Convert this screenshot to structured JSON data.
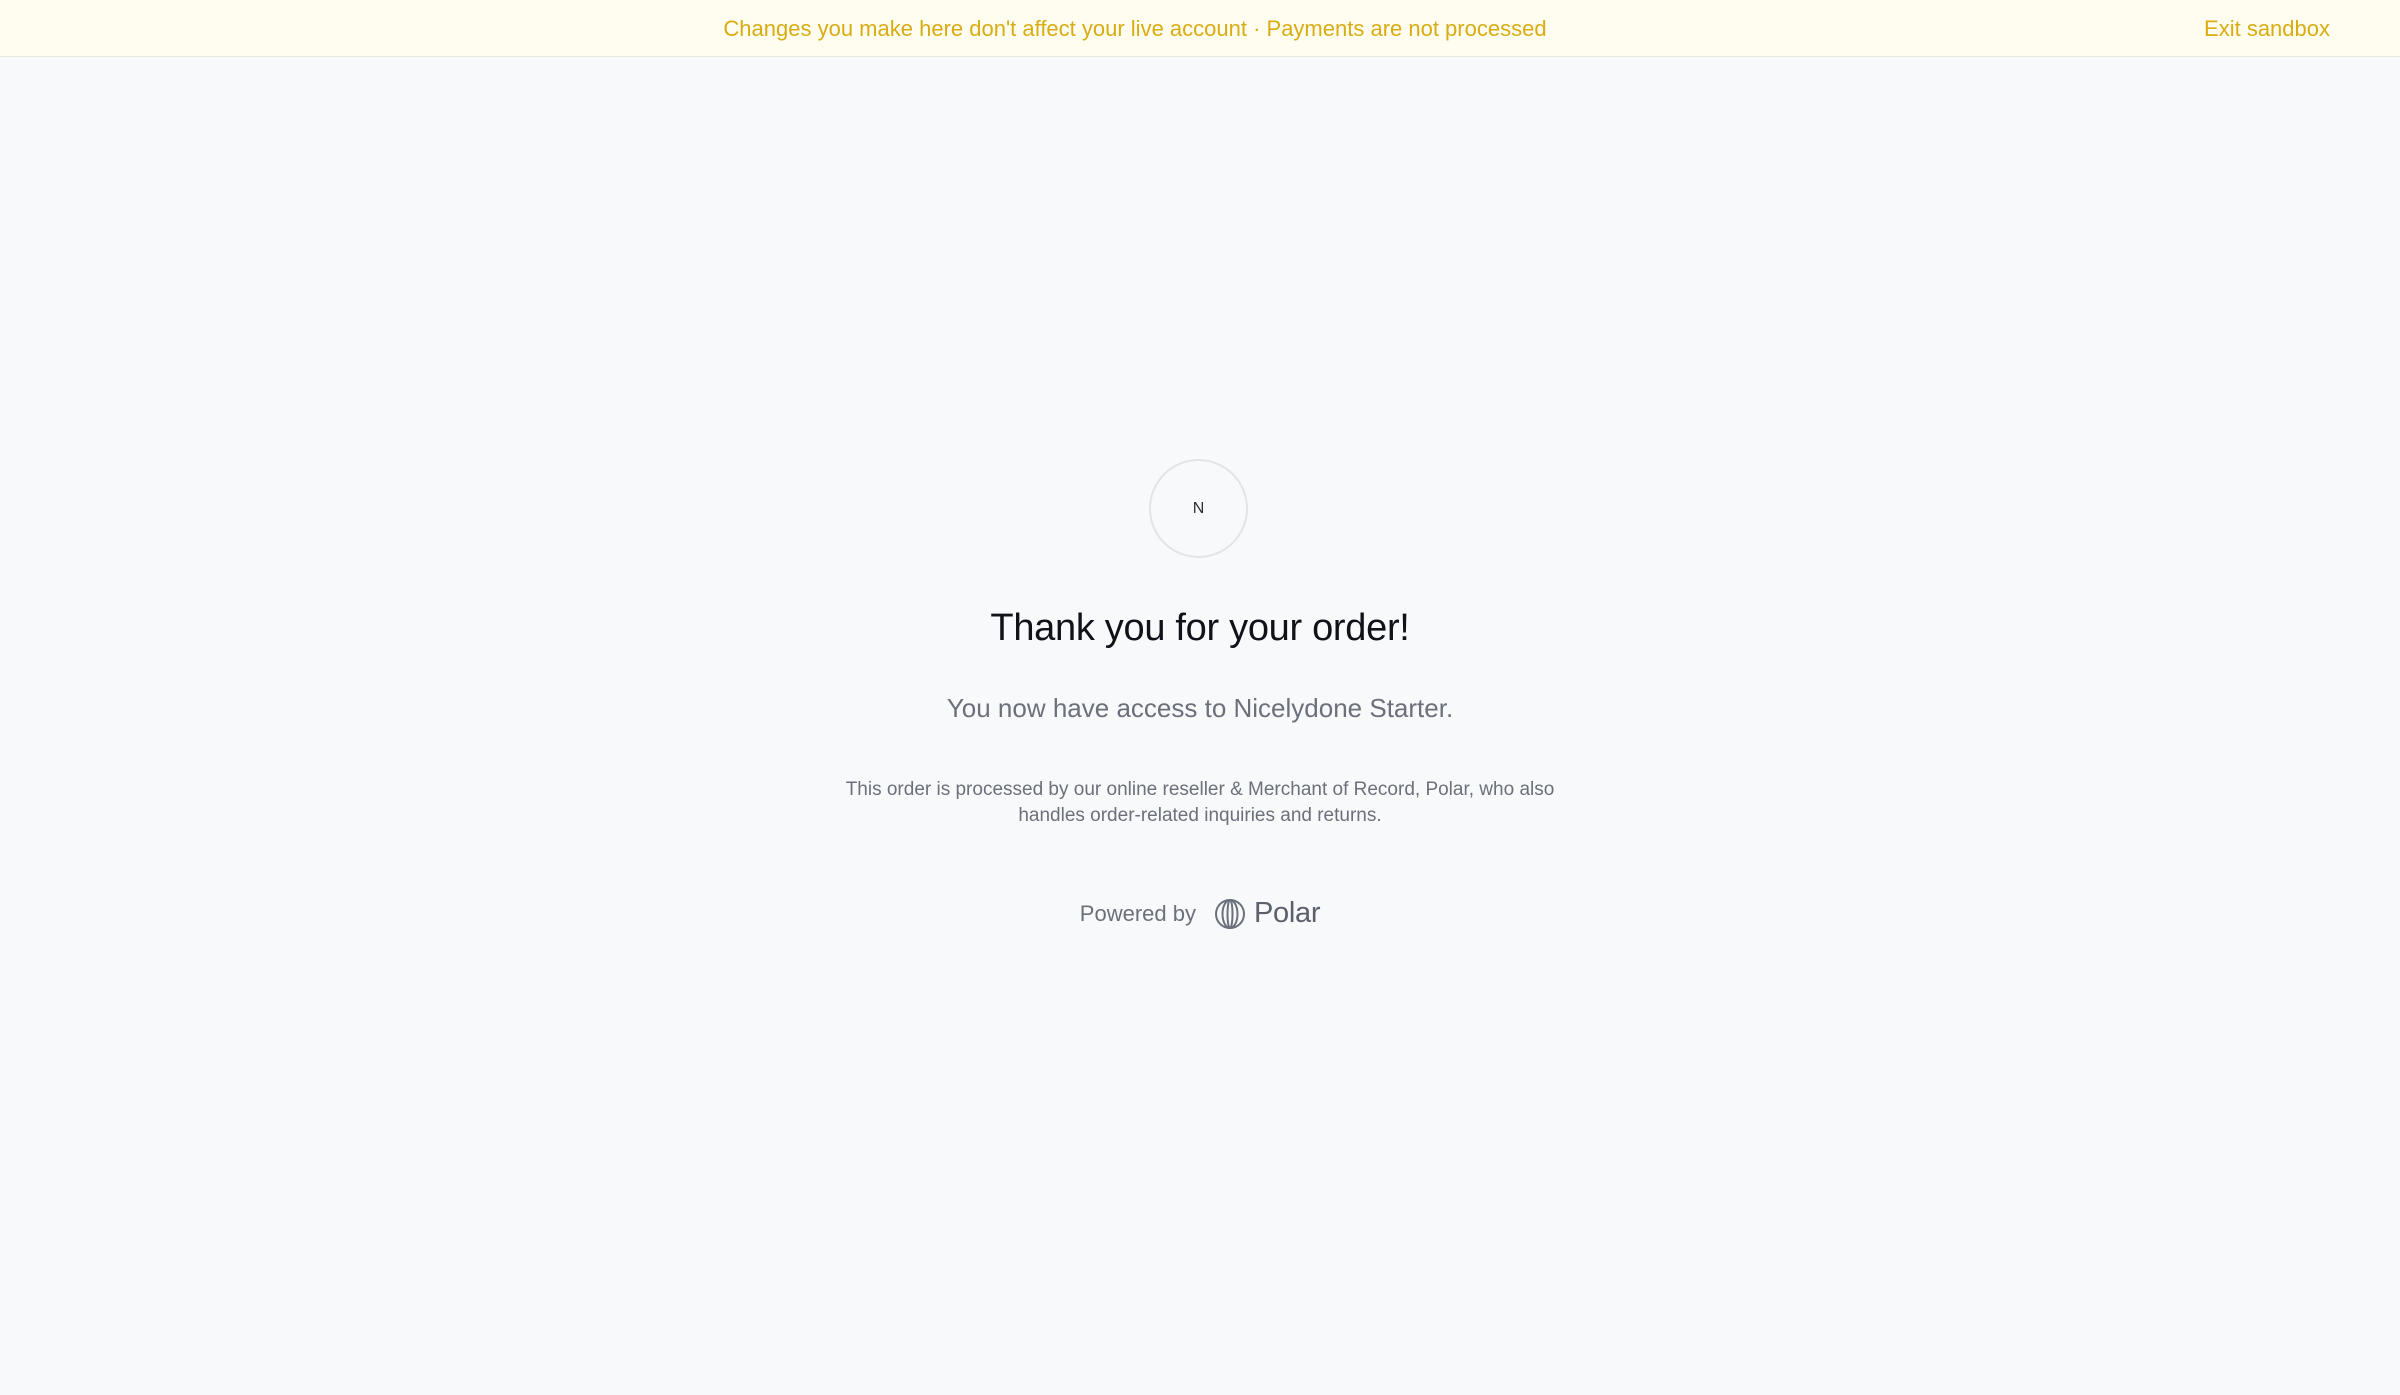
{
  "banner": {
    "message": "Changes you make here don't affect your live account · Payments are not processed",
    "exit_label": "Exit sandbox"
  },
  "avatar": {
    "initial": "N"
  },
  "confirmation": {
    "title": "Thank you for your order!",
    "access_text": "You now have access to Nicelydone Starter.",
    "merchant_note": "This order is processed by our online reseller & Merchant of Record, Polar, who also handles order-related inquiries and returns."
  },
  "footer": {
    "powered_by_label": "Powered by",
    "brand_name": "Polar",
    "brand_icon": "polar-logo-icon"
  },
  "colors": {
    "banner_text": "#d9ac12",
    "banner_background": "#fefdf0",
    "page_background": "#f8f9fb"
  }
}
